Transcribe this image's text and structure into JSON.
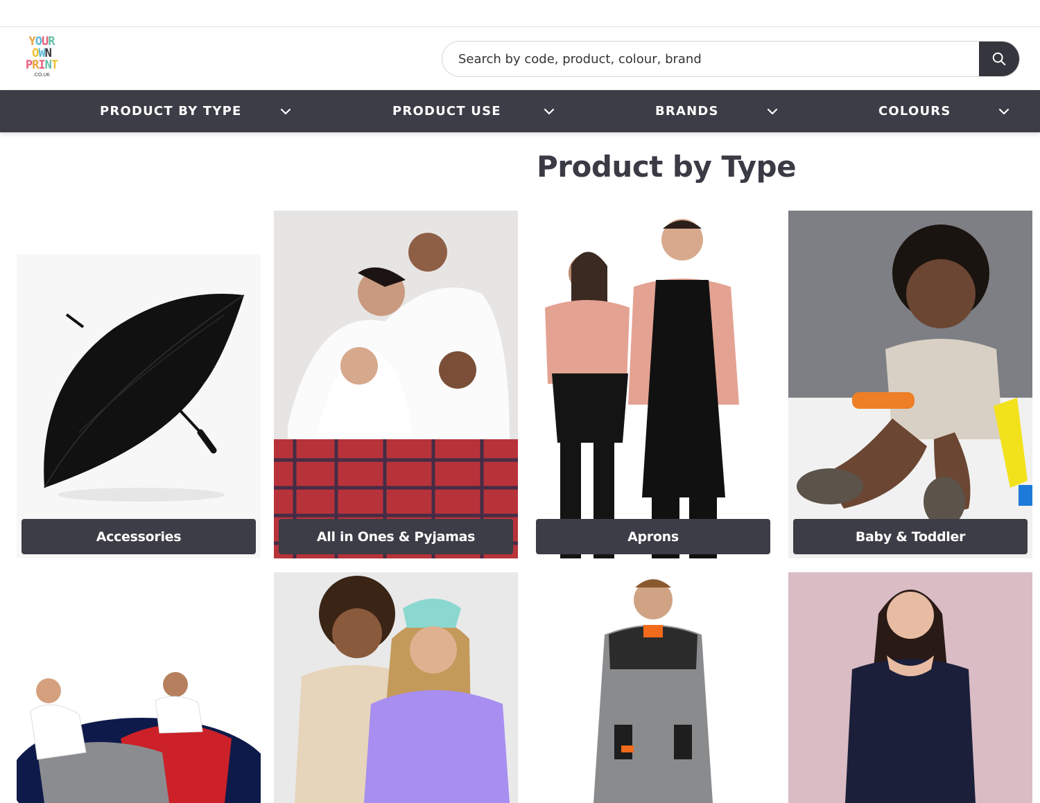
{
  "logo": {
    "rows": [
      "YOUR",
      "OWN",
      "PRINT"
    ],
    "domain": ".CO.UK"
  },
  "search": {
    "placeholder": "Search by code, product, colour, brand",
    "button_icon": "search-icon"
  },
  "nav": {
    "items": [
      {
        "label": "PRODUCT BY TYPE",
        "icon": "chevron-down-icon"
      },
      {
        "label": "PRODUCT USE",
        "icon": "chevron-down-icon"
      },
      {
        "label": "BRANDS",
        "icon": "chevron-down-icon"
      },
      {
        "label": "COLOURS",
        "icon": "chevron-down-icon"
      }
    ]
  },
  "page": {
    "title": "Product by Type"
  },
  "categories": [
    {
      "label": "Accessories"
    },
    {
      "label": "All in Ones & Pyjamas"
    },
    {
      "label": "Aprons"
    },
    {
      "label": "Baby & Toddler"
    },
    {
      "label": ""
    },
    {
      "label": ""
    },
    {
      "label": ""
    },
    {
      "label": ""
    }
  ],
  "colors": {
    "nav_bg": "#3c3d46",
    "search_button": "#34353d",
    "text_dark": "#3a3b45"
  }
}
